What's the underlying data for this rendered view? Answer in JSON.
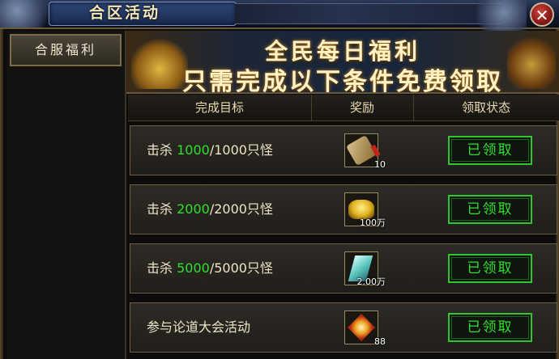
{
  "window": {
    "title": "合区活动"
  },
  "sidebar": {
    "items": [
      {
        "label": "合服福利"
      }
    ]
  },
  "banner": {
    "line1": "全民每日福利",
    "line2": "只需完成以下条件免费领取"
  },
  "table": {
    "headers": {
      "goal": "完成目标",
      "reward": "奖励",
      "status": "领取状态"
    },
    "rows": [
      {
        "prefix": "击杀 ",
        "current": "1000",
        "rest": "/1000只怪",
        "reward_icon": "scroll-icon",
        "reward_count": "10",
        "status": "已领取"
      },
      {
        "prefix": "击杀 ",
        "current": "2000",
        "rest": "/2000只怪",
        "reward_icon": "gold-ingot-icon",
        "reward_count": "100万",
        "status": "已领取"
      },
      {
        "prefix": "击杀 ",
        "current": "5000",
        "rest": "/5000只怪",
        "reward_icon": "crystal-icon",
        "reward_count": "2.00万",
        "status": "已领取"
      },
      {
        "prefix": "参与论道大会活动",
        "current": "",
        "rest": "",
        "reward_icon": "gem-icon",
        "reward_count": "88",
        "status": "已领取"
      }
    ]
  },
  "colors": {
    "accent_green": "#2ee02e",
    "gold_text": "#efe4c6"
  }
}
